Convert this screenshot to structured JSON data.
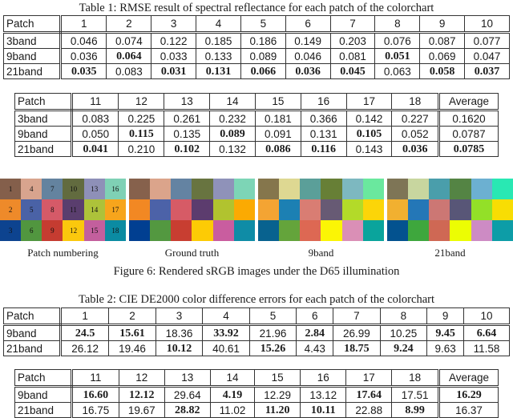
{
  "table1": {
    "caption": "Table 1: RMSE result of spectral reflectance for each patch of the colorchart",
    "part1": {
      "header": [
        "Patch",
        "1",
        "2",
        "3",
        "4",
        "5",
        "6",
        "7",
        "8",
        "9",
        "10"
      ],
      "rows": [
        {
          "label": "3band",
          "cells": [
            {
              "v": "0.046",
              "b": false
            },
            {
              "v": "0.074",
              "b": false
            },
            {
              "v": "0.122",
              "b": false
            },
            {
              "v": "0.185",
              "b": false
            },
            {
              "v": "0.186",
              "b": false
            },
            {
              "v": "0.149",
              "b": false
            },
            {
              "v": "0.203",
              "b": false
            },
            {
              "v": "0.076",
              "b": false
            },
            {
              "v": "0.087",
              "b": false
            },
            {
              "v": "0.077",
              "b": false
            }
          ]
        },
        {
          "label": "9band",
          "cells": [
            {
              "v": "0.036",
              "b": false
            },
            {
              "v": "0.064",
              "b": true
            },
            {
              "v": "0.033",
              "b": false
            },
            {
              "v": "0.133",
              "b": false
            },
            {
              "v": "0.089",
              "b": false
            },
            {
              "v": "0.046",
              "b": false
            },
            {
              "v": "0.081",
              "b": false
            },
            {
              "v": "0.051",
              "b": true
            },
            {
              "v": "0.069",
              "b": false
            },
            {
              "v": "0.047",
              "b": false
            }
          ]
        },
        {
          "label": "21band",
          "cells": [
            {
              "v": "0.035",
              "b": true
            },
            {
              "v": "0.083",
              "b": false
            },
            {
              "v": "0.031",
              "b": true
            },
            {
              "v": "0.131",
              "b": true
            },
            {
              "v": "0.066",
              "b": true
            },
            {
              "v": "0.036",
              "b": true
            },
            {
              "v": "0.045",
              "b": true
            },
            {
              "v": "0.063",
              "b": false
            },
            {
              "v": "0.058",
              "b": true
            },
            {
              "v": "0.037",
              "b": true
            }
          ]
        }
      ]
    },
    "part2": {
      "header": [
        "Patch",
        "11",
        "12",
        "13",
        "14",
        "15",
        "16",
        "17",
        "18",
        "Average"
      ],
      "rows": [
        {
          "label": "3band",
          "cells": [
            {
              "v": "0.083",
              "b": false
            },
            {
              "v": "0.225",
              "b": false
            },
            {
              "v": "0.261",
              "b": false
            },
            {
              "v": "0.232",
              "b": false
            },
            {
              "v": "0.181",
              "b": false
            },
            {
              "v": "0.366",
              "b": false
            },
            {
              "v": "0.142",
              "b": false
            },
            {
              "v": "0.227",
              "b": false
            },
            {
              "v": "0.1620",
              "b": false
            }
          ]
        },
        {
          "label": "9band",
          "cells": [
            {
              "v": "0.050",
              "b": false
            },
            {
              "v": "0.115",
              "b": true
            },
            {
              "v": "0.135",
              "b": false
            },
            {
              "v": "0.089",
              "b": true
            },
            {
              "v": "0.091",
              "b": false
            },
            {
              "v": "0.131",
              "b": false
            },
            {
              "v": "0.105",
              "b": true
            },
            {
              "v": "0.052",
              "b": false
            },
            {
              "v": "0.0787",
              "b": false
            }
          ]
        },
        {
          "label": "21band",
          "cells": [
            {
              "v": "0.041",
              "b": true
            },
            {
              "v": "0.210",
              "b": false
            },
            {
              "v": "0.102",
              "b": true
            },
            {
              "v": "0.132",
              "b": false
            },
            {
              "v": "0.086",
              "b": true
            },
            {
              "v": "0.116",
              "b": true
            },
            {
              "v": "0.143",
              "b": false
            },
            {
              "v": "0.036",
              "b": true
            },
            {
              "v": "0.0785",
              "b": true
            }
          ]
        }
      ]
    }
  },
  "figure6": {
    "caption": "Figure 6: Rendered sRGB images under the D65 illumination",
    "panels": [
      {
        "label": "Patch numbering",
        "numbers": [
          "1",
          "4",
          "7",
          "10",
          "13",
          "16",
          "2",
          "5",
          "8",
          "11",
          "14",
          "17",
          "3",
          "6",
          "9",
          "12",
          "15",
          "18"
        ],
        "colors": [
          "#845f4b",
          "#d8a48e",
          "#64839f",
          "#626b3f",
          "#8e90b8",
          "#7fd1b5",
          "#ee8a2a",
          "#4a62a6",
          "#d55a68",
          "#5a3e6e",
          "#adc23a",
          "#f7a51c",
          "#0d438f",
          "#51963f",
          "#c53c31",
          "#fbc80d",
          "#c35f9d",
          "#0b8ba2"
        ]
      },
      {
        "label": "Ground truth",
        "numbers": [],
        "colors": [
          "#86614c",
          "#dba48b",
          "#6483a2",
          "#687440",
          "#8f92b9",
          "#7dd5b6",
          "#f28823",
          "#4c62a8",
          "#d65b66",
          "#5c3c6e",
          "#b1c32f",
          "#fbaa02",
          "#013f91",
          "#539840",
          "#c83e31",
          "#fdcb05",
          "#c95d9f",
          "#0f8ca6"
        ]
      },
      {
        "label": "9band",
        "numbers": [],
        "colors": [
          "#85764c",
          "#ded892",
          "#5b9f99",
          "#677f36",
          "#7db8c0",
          "#6ae89e",
          "#f4a433",
          "#1c80b3",
          "#d97d73",
          "#675a74",
          "#b3da29",
          "#fcd508",
          "#08628f",
          "#64a43b",
          "#dd6853",
          "#fbf505",
          "#da8fb6",
          "#0aa49c"
        ]
      },
      {
        "label": "21band",
        "numbers": [],
        "colors": [
          "#7e7556",
          "#c8d69f",
          "#4a9eab",
          "#548444",
          "#6cb0d1",
          "#29e8b3",
          "#f1b030",
          "#2477b7",
          "#cc7774",
          "#585677",
          "#93e028",
          "#f8dd03",
          "#03528f",
          "#3ea73d",
          "#cf6854",
          "#ecfd03",
          "#cd8bc4",
          "#0d9da7"
        ]
      }
    ]
  },
  "table2": {
    "caption": "Table 2: CIE DE2000 color difference errors for each patch of the colorchart",
    "part1": {
      "header": [
        "Patch",
        "1",
        "2",
        "3",
        "4",
        "5",
        "6",
        "7",
        "8",
        "9",
        "10"
      ],
      "rows": [
        {
          "label": "9band",
          "cells": [
            {
              "v": "24.5",
              "b": true
            },
            {
              "v": "15.61",
              "b": true
            },
            {
              "v": "18.36",
              "b": false
            },
            {
              "v": "33.92",
              "b": true
            },
            {
              "v": "21.96",
              "b": false
            },
            {
              "v": "2.84",
              "b": true
            },
            {
              "v": "26.99",
              "b": false
            },
            {
              "v": "10.25",
              "b": false
            },
            {
              "v": "9.45",
              "b": true
            },
            {
              "v": "6.64",
              "b": true
            }
          ]
        },
        {
          "label": "21band",
          "cells": [
            {
              "v": "26.12",
              "b": false
            },
            {
              "v": "19.46",
              "b": false
            },
            {
              "v": "10.12",
              "b": true
            },
            {
              "v": "40.61",
              "b": false
            },
            {
              "v": "15.26",
              "b": true
            },
            {
              "v": "4.43",
              "b": false
            },
            {
              "v": "18.75",
              "b": true
            },
            {
              "v": "9.24",
              "b": true
            },
            {
              "v": "9.63",
              "b": false
            },
            {
              "v": "11.58",
              "b": false
            }
          ]
        }
      ]
    },
    "part2": {
      "header": [
        "Patch",
        "11",
        "12",
        "13",
        "14",
        "15",
        "16",
        "17",
        "18",
        "Average"
      ],
      "rows": [
        {
          "label": "9band",
          "cells": [
            {
              "v": "16.60",
              "b": true
            },
            {
              "v": "12.12",
              "b": true
            },
            {
              "v": "29.64",
              "b": false
            },
            {
              "v": "4.19",
              "b": true
            },
            {
              "v": "12.29",
              "b": false
            },
            {
              "v": "13.12",
              "b": false
            },
            {
              "v": "17.64",
              "b": true
            },
            {
              "v": "17.51",
              "b": false
            },
            {
              "v": "16.29",
              "b": true
            }
          ]
        },
        {
          "label": "21band",
          "cells": [
            {
              "v": "16.75",
              "b": false
            },
            {
              "v": "19.67",
              "b": false
            },
            {
              "v": "28.82",
              "b": true
            },
            {
              "v": "11.02",
              "b": false
            },
            {
              "v": "11.20",
              "b": true
            },
            {
              "v": "10.11",
              "b": true
            },
            {
              "v": "22.88",
              "b": false
            },
            {
              "v": "8.99",
              "b": true
            },
            {
              "v": "16.37",
              "b": false
            }
          ]
        }
      ]
    }
  }
}
